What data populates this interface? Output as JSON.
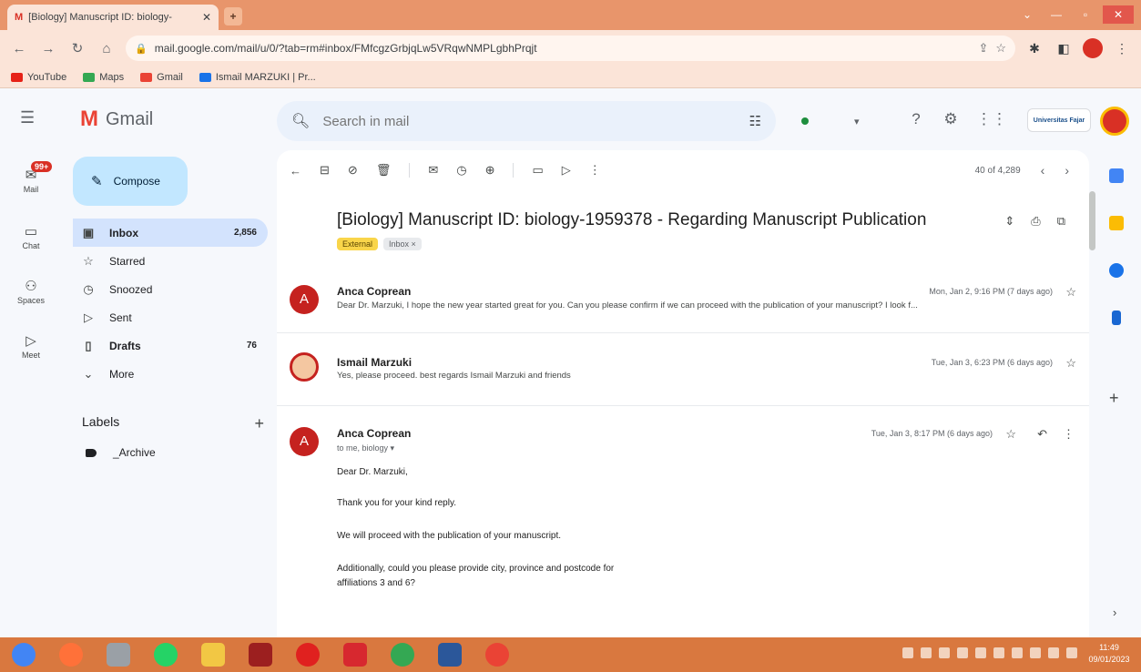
{
  "browser": {
    "tab_title": "[Biology] Manuscript ID: biology-",
    "tab_favicon": "M",
    "url": "mail.google.com/mail/u/0/?tab=rm#inbox/FMfcgzGrbjqLw5VRqwNMPLgbhPrqjt",
    "bookmarks": [
      "YouTube",
      "Maps",
      "Gmail",
      "Ismail MARZUKI | Pr..."
    ]
  },
  "gmail": {
    "app_name": "Gmail",
    "logo_letter": "M",
    "search_placeholder": "Search in mail",
    "org_badge": "Universitas Fajar",
    "rail": [
      {
        "label": "Mail",
        "badge": "99+"
      },
      {
        "label": "Chat"
      },
      {
        "label": "Spaces"
      },
      {
        "label": "Meet"
      }
    ],
    "compose_label": "Compose",
    "nav": [
      {
        "label": "Inbox",
        "count": "2,856",
        "icon": "inbox-icon"
      },
      {
        "label": "Starred",
        "count": "",
        "icon": "star-icon"
      },
      {
        "label": "Snoozed",
        "count": "",
        "icon": "clock-icon"
      },
      {
        "label": "Sent",
        "count": "",
        "icon": "send-icon"
      },
      {
        "label": "Drafts",
        "count": "76",
        "icon": "draft-icon"
      },
      {
        "label": "More",
        "count": "",
        "icon": "chevron-down-icon"
      }
    ],
    "labels_title": "Labels",
    "labels": [
      "_Archive"
    ]
  },
  "thread": {
    "pager": "40 of 4,289",
    "subject": "[Biology] Manuscript ID: biology-1959378 - Regarding Manuscript Publication",
    "tags": [
      "External",
      "Inbox ×"
    ],
    "messages": [
      {
        "from": "Anca Coprean",
        "avatar_letter": "A",
        "date": "Mon, Jan 2, 9:16 PM (7 days ago)",
        "snippet": "Dear Dr. Marzuki, I hope the new year started great for you. Can you please confirm if we can proceed with the publication of your manuscript? I look f..."
      },
      {
        "from": "Ismail Marzuki",
        "avatar_letter": "",
        "date": "Tue, Jan 3, 6:23 PM (6 days ago)",
        "snippet": "Yes, please proceed. best regards Ismail Marzuki and friends"
      },
      {
        "from": "Anca Coprean",
        "avatar_letter": "A",
        "date": "Tue, Jan 3, 8:17 PM (6 days ago)",
        "to": "to me, biology ▾",
        "body": [
          "Dear Dr. Marzuki,",
          "Thank you for your kind reply.",
          "We will proceed with the publication of your manuscript.",
          "Additionally, could you please provide city, province and postcode for",
          "affiliations 3 and 6?"
        ]
      }
    ]
  },
  "taskbar": {
    "time": "11:49",
    "date": "09/01/2023"
  },
  "colors": {
    "chrome_tabbar": "#e8956b",
    "chrome_toolbar": "#fbe4d8",
    "compose_bg": "#c2e7ff",
    "inbox_active": "#d3e3fd",
    "avatar_red": "#c5221f",
    "taskbar": "#d9783f"
  }
}
